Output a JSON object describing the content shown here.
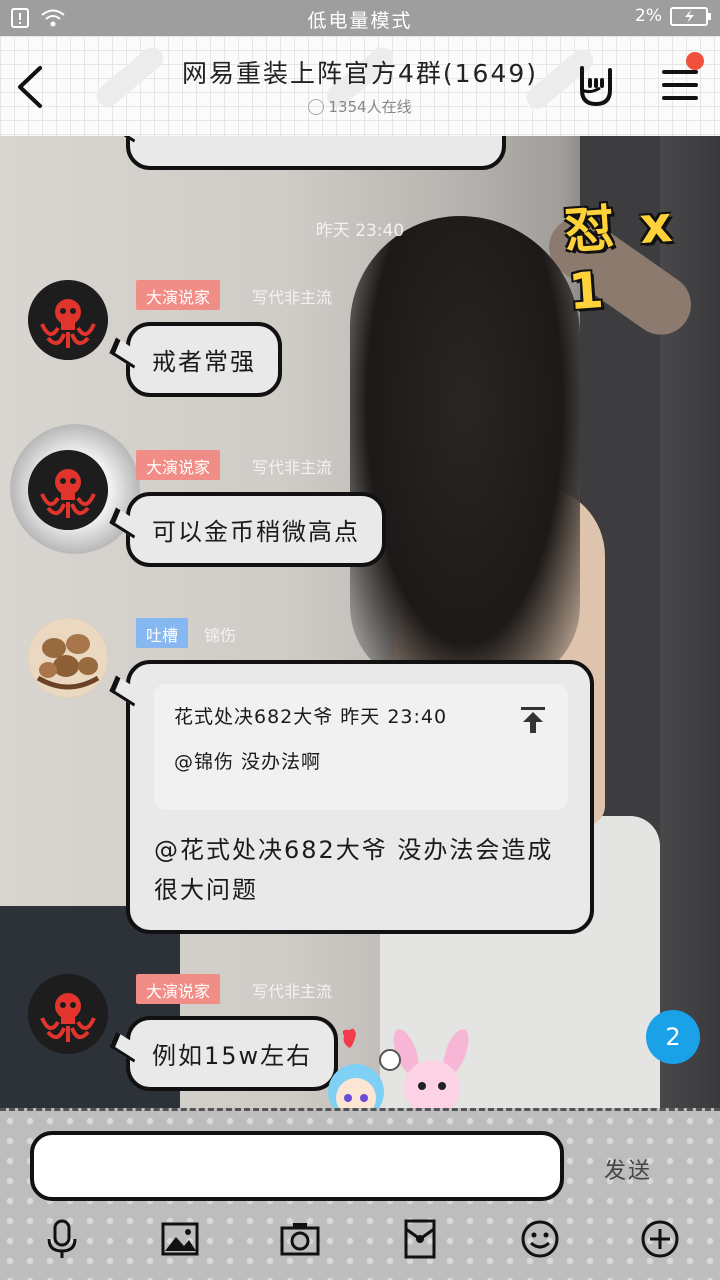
{
  "status_bar": {
    "mode_text": "低电量模式",
    "battery_text": "2%"
  },
  "header": {
    "title": "网易重装上阵官方4群(1649)",
    "online_text": "1354人在线"
  },
  "chat": {
    "time_label": "昨天 23:40",
    "badge_text": "怼 x 1",
    "messages": [
      {
        "tag": "大演说家",
        "tag_color": "#f08d86",
        "sender": "写代非主流",
        "text": "戒者常强",
        "avatar": "hydra-icon"
      },
      {
        "tag": "大演说家",
        "tag_color": "#f08d86",
        "sender": "写代非主流",
        "text": "可以金币稍微高点",
        "avatar": "hydra-icon"
      },
      {
        "tag": "吐槽",
        "tag_color": "#86b7f0",
        "sender": "锦伤",
        "avatar": "walnut-icon",
        "quote": {
          "line1": "花式处决682大爷 昨天 23:40",
          "line2": "@锦伤 没办法啊"
        },
        "text": "@花式处决682大爷 没办法会造成很大问题"
      },
      {
        "tag": "大演说家",
        "tag_color": "#f08d86",
        "sender": "写代非主流",
        "text": "例如15w左右",
        "avatar": "hydra-icon"
      }
    ],
    "unread_count": "2"
  },
  "input_bar": {
    "placeholder": "",
    "send_label": "发送"
  },
  "toolbar": {
    "icons": [
      "mic-icon",
      "image-icon",
      "camera-icon",
      "red-packet-icon",
      "emoji-icon",
      "plus-icon"
    ]
  }
}
